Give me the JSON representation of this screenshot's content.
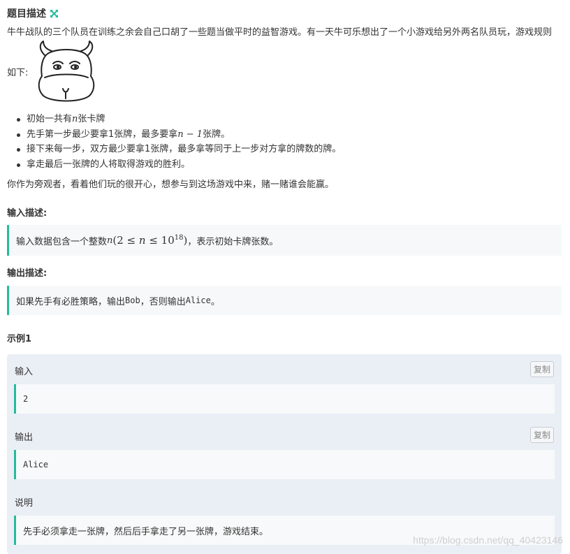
{
  "header": {
    "title": "题目描述",
    "expand_icon": "expand-arrows-icon"
  },
  "description": {
    "intro_line1": "牛牛战队的三个队员在训练之余会自己口胡了一些题当做平时的益智游戏。有一天牛可乐想出了一个小游戏给另外两名队员玩，游戏规则",
    "intro_line2": "如下:",
    "image_icon": "cartoon-cow-icon",
    "rules": [
      {
        "pre": "初始一共有",
        "math": "n",
        "post": "张卡牌"
      },
      {
        "pre": "先手第一步最少要拿1张牌，最多要拿",
        "math": "n − 1",
        "post": "张牌。"
      },
      {
        "pre": "接下来每一步，双方最少要拿1张牌，最多拿等同于上一步对方拿的牌数的牌。",
        "math": "",
        "post": ""
      },
      {
        "pre": "拿走最后一张牌的人将取得游戏的胜利。",
        "math": "",
        "post": ""
      }
    ],
    "spectator": "你作为旁观者，看着他们玩的很开心，想参与到这场游戏中来，赌一赌谁会能赢。"
  },
  "input_desc": {
    "title": "输入描述:",
    "pre": "输入数据包含一个整数",
    "var": "n",
    "constraint_open": "(2 ≤ ",
    "constraint_var": "n",
    "constraint_mid": " ≤ 10",
    "constraint_exp": "18",
    "constraint_close": ")",
    "post": "，表示初始卡牌张数。"
  },
  "output_desc": {
    "title": "输出描述:",
    "pre": "如果先手有必胜策略，输出",
    "bob": "Bob",
    "mid": "，否则输出",
    "alice": "Alice",
    "post": "。"
  },
  "example": {
    "title": "示例1",
    "input_label": "输入",
    "input_value": "2",
    "output_label": "输出",
    "output_value": "Alice",
    "explain_label": "说明",
    "explain_value": "先手必须拿走一张牌，然后后手拿走了另一张牌，游戏结束。",
    "copy_label": "复制"
  },
  "watermark": "https://blog.csdn.net/qq_40423146",
  "colors": {
    "accent": "#25bb9b",
    "example_bg": "#eaeef5",
    "quote_bg": "#f7f8fa"
  }
}
